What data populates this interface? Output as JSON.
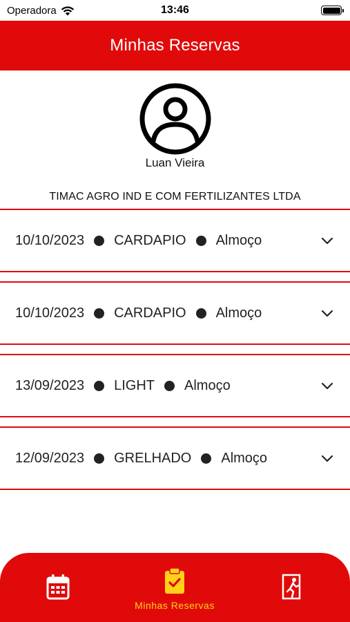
{
  "status_bar": {
    "carrier": "Operadora",
    "time": "13:46"
  },
  "header": {
    "title": "Minhas Reservas"
  },
  "profile": {
    "name": "Luan Vieira",
    "company": "TIMAC AGRO IND E COM FERTILIZANTES LTDA"
  },
  "reservations": [
    {
      "date": "10/10/2023",
      "menu": "CARDAPIO",
      "meal": "Almoço"
    },
    {
      "date": "10/10/2023",
      "menu": "CARDAPIO",
      "meal": "Almoço"
    },
    {
      "date": "13/09/2023",
      "menu": "LIGHT",
      "meal": "Almoço"
    },
    {
      "date": "12/09/2023",
      "menu": "GRELHADO",
      "meal": "Almoço"
    }
  ],
  "bottom_nav": {
    "items": [
      {
        "icon": "calendar-icon",
        "label": ""
      },
      {
        "icon": "clipboard-check-icon",
        "label": "Minhas Reservas"
      },
      {
        "icon": "exit-door-icon",
        "label": ""
      }
    ]
  },
  "colors": {
    "brand_red": "#e10a0a",
    "active_yellow": "#ffd21a"
  }
}
